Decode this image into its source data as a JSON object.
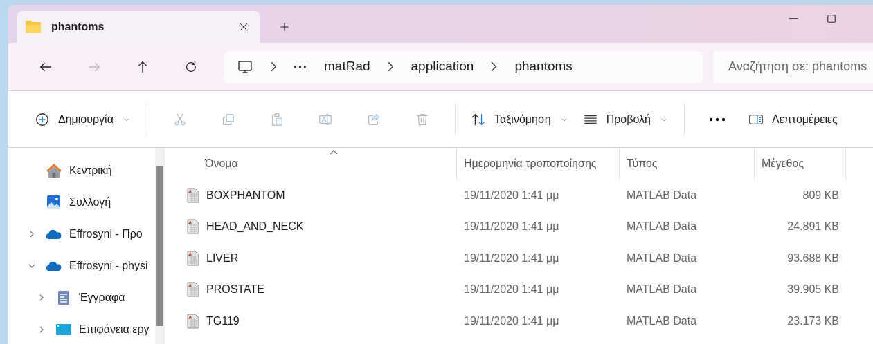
{
  "tab": {
    "title": "phantoms"
  },
  "address": {
    "segments": [
      "matRad",
      "application",
      "phantoms"
    ]
  },
  "search": {
    "placeholder": "Αναζήτηση σε: phantoms"
  },
  "toolbar": [
    {
      "kind": "new",
      "label": "Δημιουργία",
      "disabled": false
    },
    {
      "kind": "cut",
      "disabled": true
    },
    {
      "kind": "copy",
      "disabled": true
    },
    {
      "kind": "paste",
      "disabled": true
    },
    {
      "kind": "rename",
      "disabled": true
    },
    {
      "kind": "share",
      "disabled": true
    },
    {
      "kind": "delete",
      "disabled": true
    },
    {
      "kind": "sort",
      "label": "Ταξινόμηση",
      "disabled": false
    },
    {
      "kind": "view",
      "label": "Προβολή",
      "disabled": false
    },
    {
      "kind": "more",
      "disabled": false
    },
    {
      "kind": "details",
      "label": "Λεπτομέρειες",
      "disabled": false
    }
  ],
  "sidebar": {
    "items": [
      {
        "kind": "home",
        "label": "Κεντρική"
      },
      {
        "kind": "gallery",
        "label": "Συλλογή"
      },
      {
        "kind": "cloud",
        "label": "Effrosyni - Προ",
        "expanded": false
      },
      {
        "kind": "cloud",
        "label": "Effrosyni - physi",
        "expanded": true,
        "children": [
          {
            "kind": "documents",
            "label": "Έγγραφα",
            "expanded": false
          },
          {
            "kind": "desktop",
            "label": "Επιφάνεια εργ",
            "expanded": false
          }
        ]
      }
    ]
  },
  "table": {
    "columns": [
      "Όνομα",
      "Ημερομηνία τροποποίησης",
      "Τύπος",
      "Μέγεθος"
    ],
    "rows": [
      {
        "name": "BOXPHANTOM",
        "date": "19/11/2020 1:41 μμ",
        "type": "MATLAB Data",
        "size": "809 KB"
      },
      {
        "name": "HEAD_AND_NECK",
        "date": "19/11/2020 1:41 μμ",
        "type": "MATLAB Data",
        "size": "24.891 KB"
      },
      {
        "name": "LIVER",
        "date": "19/11/2020 1:41 μμ",
        "type": "MATLAB Data",
        "size": "93.688 KB"
      },
      {
        "name": "PROSTATE",
        "date": "19/11/2020 1:41 μμ",
        "type": "MATLAB Data",
        "size": "39.905 KB"
      },
      {
        "name": "TG119",
        "date": "19/11/2020 1:41 μμ",
        "type": "MATLAB Data",
        "size": "23.173 KB"
      }
    ]
  }
}
